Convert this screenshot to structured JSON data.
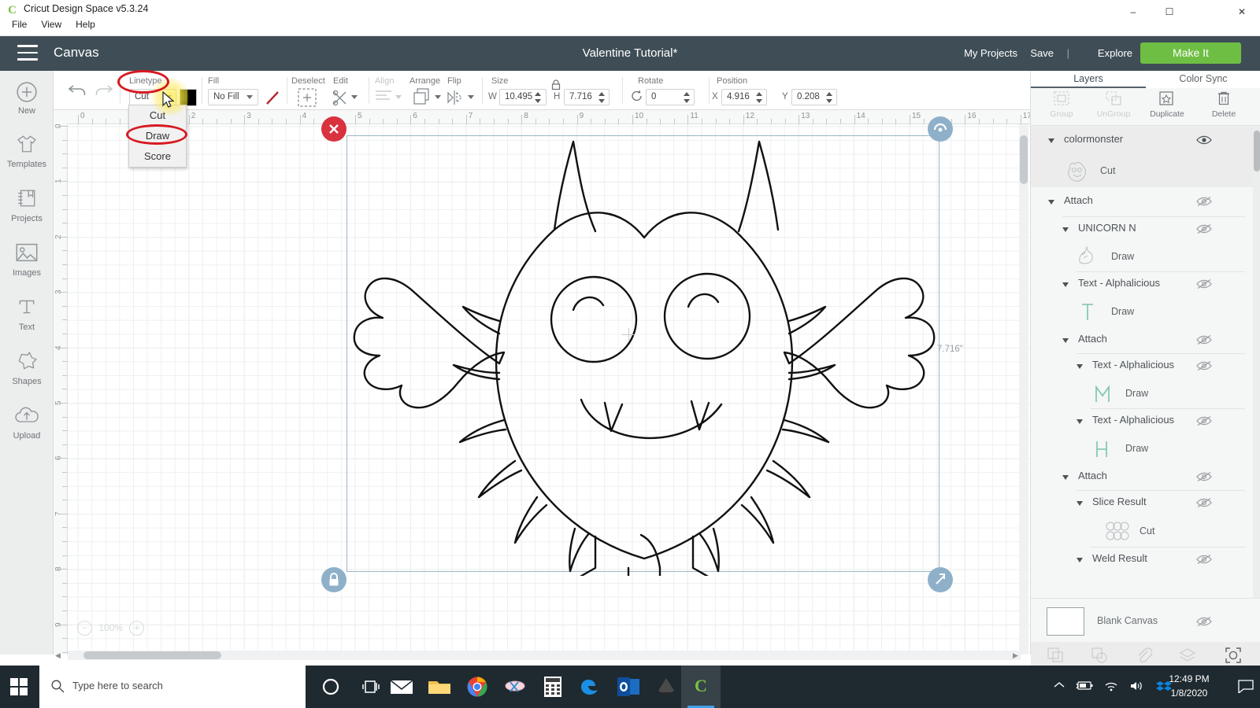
{
  "window": {
    "app_title": "Cricut Design Space  v5.3.24",
    "app_icon": "cricut-logo-icon",
    "menus": [
      "File",
      "View",
      "Help"
    ],
    "buttons": {
      "minimize": "minimize-icon",
      "maximize": "maximize-icon",
      "close": "close-icon"
    }
  },
  "header": {
    "canvas_label": "Canvas",
    "doc_title": "Valentine Tutorial*",
    "my_projects": "My Projects",
    "save": "Save",
    "separator": "|",
    "explore": "Explore",
    "make_it": "Make It",
    "accent_green": "#6ebe44",
    "bar_color": "#3f4e56"
  },
  "sidebar": {
    "items": [
      {
        "label": "New",
        "icon": "plus-circle-icon"
      },
      {
        "label": "Templates",
        "icon": "tshirt-icon"
      },
      {
        "label": "Projects",
        "icon": "book-icon"
      },
      {
        "label": "Images",
        "icon": "picture-icon"
      },
      {
        "label": "Text",
        "icon": "text-t-icon"
      },
      {
        "label": "Shapes",
        "icon": "star-shape-icon"
      },
      {
        "label": "Upload",
        "icon": "cloud-upload-icon"
      }
    ]
  },
  "toolbar": {
    "undo": "undo-icon",
    "redo": "redo-icon",
    "linetype": {
      "label": "Linetype",
      "value": "Cut",
      "swatch_color": "#000000"
    },
    "fill": {
      "label": "Fill",
      "value": "No Fill",
      "stroke_icon": "diagonal-red-line-icon"
    },
    "deselect": {
      "label": "Deselect",
      "icon": "dashed-plus-icon"
    },
    "edit": {
      "label": "Edit",
      "icon": "scissors-icon"
    },
    "align": {
      "label": "Align",
      "icon": "align-icon",
      "disabled": true
    },
    "arrange": {
      "label": "Arrange",
      "icon": "layers-arrange-icon"
    },
    "flip": {
      "label": "Flip",
      "icon": "flip-icon"
    },
    "size": {
      "label": "Size",
      "w_label": "W",
      "w_value": "10.495",
      "h_label": "H",
      "h_value": "7.716",
      "lock_icon": "lock-icon"
    },
    "rotate": {
      "label": "Rotate",
      "value": "0",
      "icon": "rotate-icon"
    },
    "position": {
      "label": "Position",
      "x_label": "X",
      "x_value": "4.916",
      "y_label": "Y",
      "y_value": "0.208"
    }
  },
  "linetype_menu": {
    "options": [
      "Cut",
      "Draw",
      "Score"
    ],
    "highlighted_option": "Draw",
    "highlight_color": "#d71920"
  },
  "canvas": {
    "ruler_h": [
      "0",
      "1",
      "2",
      "3",
      "4",
      "5",
      "6",
      "7",
      "8",
      "9",
      "10",
      "11",
      "12",
      "13",
      "14",
      "15",
      "16",
      "17"
    ],
    "ruler_v": [
      "0",
      "1",
      "2",
      "3",
      "4",
      "5",
      "6",
      "7",
      "8",
      "9"
    ],
    "dimension_label": "7.716\"",
    "zoom_level": "100%",
    "zoom_out": "−",
    "zoom_in": "+",
    "handles": {
      "delete": "delete-handle-icon",
      "rotate": "rotate-handle-icon",
      "lock": "lock-handle-icon",
      "resize": "resize-handle-icon"
    },
    "artwork": "color-monster-line-drawing"
  },
  "right_panel": {
    "tabs": [
      {
        "label": "Layers",
        "active": true
      },
      {
        "label": "Color Sync",
        "active": false
      }
    ],
    "tools": [
      {
        "label": "Group",
        "icon": "group-icon",
        "disabled": true
      },
      {
        "label": "UnGroup",
        "icon": "ungroup-icon",
        "disabled": true
      },
      {
        "label": "Duplicate",
        "icon": "duplicate-icon",
        "disabled": false
      },
      {
        "label": "Delete",
        "icon": "trash-icon",
        "disabled": false
      }
    ],
    "layers": [
      {
        "name": "colormonster",
        "type": "group",
        "indent": 0,
        "expanded": true,
        "eye": "eye-visible-icon"
      },
      {
        "name": "Cut",
        "type": "child",
        "indent": 1,
        "thumb": "monster-thumb-icon"
      },
      {
        "name": "Attach",
        "type": "group",
        "indent": 0,
        "expanded": true,
        "eye": "eye-hidden-icon"
      },
      {
        "name": "UNICORN N",
        "type": "group",
        "indent": 1,
        "expanded": true,
        "eye": "eye-hidden-icon"
      },
      {
        "name": "Draw",
        "type": "child",
        "indent": 2,
        "thumb": "unicorn-thumb-icon"
      },
      {
        "name": "Text - Alphalicious",
        "type": "group",
        "indent": 1,
        "expanded": true,
        "eye": "eye-hidden-icon"
      },
      {
        "name": "Draw",
        "type": "child",
        "indent": 2,
        "thumb": "letter-t-icon"
      },
      {
        "name": "Attach",
        "type": "group",
        "indent": 1,
        "expanded": true,
        "eye": "eye-hidden-icon"
      },
      {
        "name": "Text - Alphalicious",
        "type": "group",
        "indent": 2,
        "expanded": true,
        "eye": "eye-hidden-icon"
      },
      {
        "name": "Draw",
        "type": "child",
        "indent": 3,
        "thumb": "letter-m-icon"
      },
      {
        "name": "Text - Alphalicious",
        "type": "group",
        "indent": 2,
        "expanded": true,
        "eye": "eye-hidden-icon"
      },
      {
        "name": "Draw",
        "type": "child",
        "indent": 3,
        "thumb": "letter-h-icon"
      },
      {
        "name": "Attach",
        "type": "group",
        "indent": 1,
        "expanded": true,
        "eye": "eye-hidden-icon"
      },
      {
        "name": "Slice Result",
        "type": "group",
        "indent": 2,
        "expanded": true,
        "eye": "eye-hidden-icon"
      },
      {
        "name": "Cut",
        "type": "child",
        "indent": 3,
        "thumb": "circles-thumb-icon"
      },
      {
        "name": "Weld Result",
        "type": "group",
        "indent": 2,
        "expanded": true,
        "eye": "eye-hidden-icon"
      }
    ],
    "blank_canvas": {
      "label": "Blank Canvas",
      "eye": "eye-hidden-icon",
      "swatch": "#ffffff"
    },
    "bottom_tools": [
      {
        "label": "Slice",
        "icon": "slice-icon",
        "enabled": false
      },
      {
        "label": "Weld",
        "icon": "weld-icon",
        "enabled": false
      },
      {
        "label": "Attach",
        "icon": "paperclip-icon",
        "enabled": false
      },
      {
        "label": "Flatten",
        "icon": "flatten-icon",
        "enabled": false
      },
      {
        "label": "Contour",
        "icon": "contour-icon",
        "enabled": true
      }
    ]
  },
  "taskbar": {
    "start": "windows-start-icon",
    "search_placeholder": "Type here to search",
    "search_icon": "magnifier-icon",
    "cortana": "cortana-circle-icon",
    "taskview": "task-view-icon",
    "apps": [
      {
        "name": "mail-icon"
      },
      {
        "name": "file-explorer-icon"
      },
      {
        "name": "chrome-icon"
      },
      {
        "name": "snip-sketch-icon"
      },
      {
        "name": "calculator-icon"
      },
      {
        "name": "edge-icon"
      },
      {
        "name": "outlook-icon"
      },
      {
        "name": "inkscape-icon"
      },
      {
        "name": "cricut-icon",
        "active": true
      }
    ],
    "tray": [
      "chevron-up-icon",
      "battery-icon",
      "wifi-icon",
      "volume-icon",
      "dropbox-icon"
    ],
    "time": "12:49 PM",
    "date": "1/8/2020",
    "notifications": "notification-icon"
  }
}
